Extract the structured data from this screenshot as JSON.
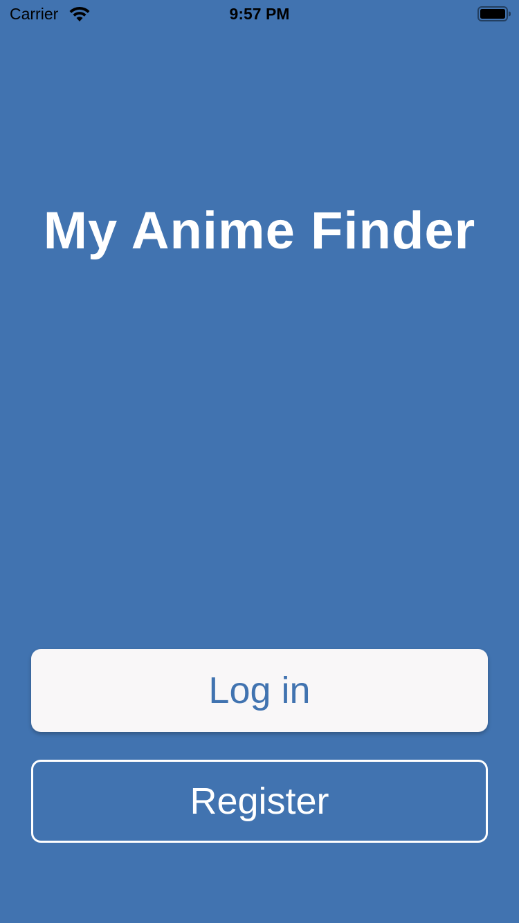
{
  "status_bar": {
    "carrier": "Carrier",
    "time": "9:57 PM",
    "wifi_icon": "wifi-icon",
    "battery_icon": "battery-icon"
  },
  "app": {
    "title": "My Anime Finder"
  },
  "actions": {
    "login_label": "Log in",
    "register_label": "Register"
  },
  "colors": {
    "background": "#4173B0",
    "login_button_bg": "#F9F7F8",
    "login_text": "#4173B0",
    "register_border": "#FFFFFF",
    "text_light": "#FFFFFF"
  }
}
